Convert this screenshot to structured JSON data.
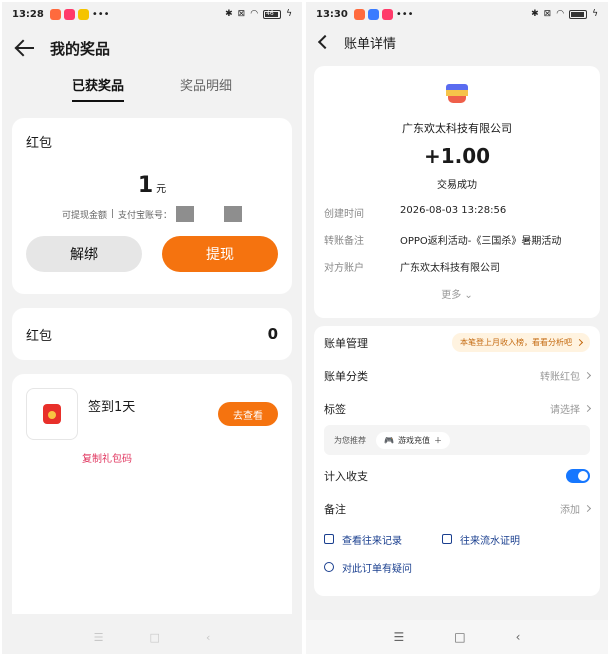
{
  "left": {
    "status": {
      "time": "13:28",
      "battery": "46"
    },
    "header": {
      "title": "我的奖品"
    },
    "tabs": [
      "已获奖品",
      "奖品明细"
    ],
    "card1": {
      "label": "红包",
      "amount": "1",
      "unit": "元",
      "subtext_a": "可提现金额",
      "subtext_b": "支付宝账号：",
      "unbind_label": "解绑",
      "withdraw_label": "提现"
    },
    "card2": {
      "label": "红包",
      "count": "0"
    },
    "card3": {
      "prize_name": "签到1天",
      "copy_label": "复制礼包码",
      "view_label": "去查看"
    },
    "nav": [
      "☰",
      "□",
      "‹"
    ]
  },
  "right": {
    "status": {
      "time": "13:30"
    },
    "header": {
      "title": "账单详情"
    },
    "merchant": "广东欢太科技有限公司",
    "amount": "+1.00",
    "status_text": "交易成功",
    "details": [
      {
        "k": "创建时间",
        "v": "2026-08-03 13:28:56"
      },
      {
        "k": "转账备注",
        "v": "OPPO返利活动-《三国杀》暑期活动"
      },
      {
        "k": "对方账户",
        "v": "广东欢太科技有限公司"
      }
    ],
    "more": "更多",
    "manage": {
      "label": "账单管理",
      "pill": "本笔登上月收入榜，看看分析吧"
    },
    "category": {
      "label": "账单分类",
      "value": "转账红包"
    },
    "tag": {
      "label": "标签",
      "value": "请选择"
    },
    "suggest": {
      "label": "为您推荐",
      "chip": "游戏充值"
    },
    "count_in": {
      "label": "计入收支"
    },
    "remark": {
      "label": "备注",
      "value": "添加"
    },
    "links": {
      "records": "查看往来记录",
      "proof": "往来流水证明",
      "question": "对此订单有疑问"
    },
    "nav": [
      "☰",
      "□",
      "‹"
    ]
  }
}
